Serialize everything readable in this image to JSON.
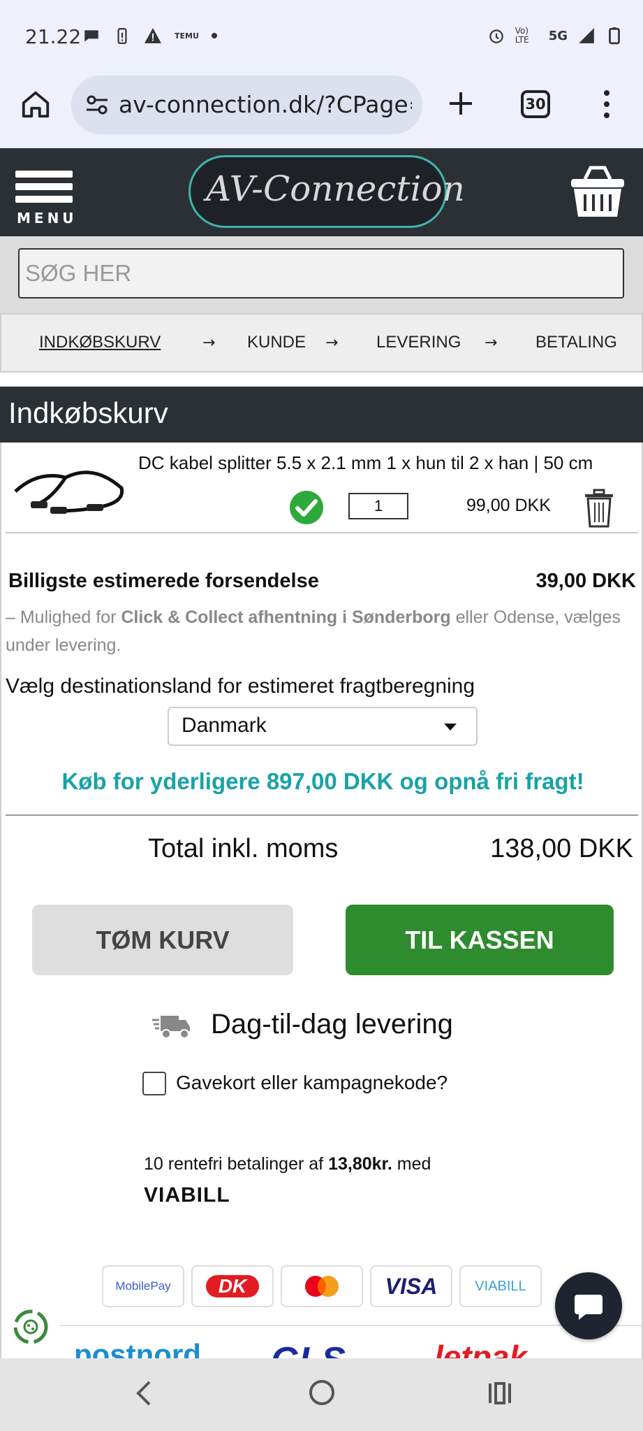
{
  "status": {
    "time": "21.22",
    "tiny_app_label": "TEMU",
    "net_label": "5G",
    "volte": "Vo) LTE"
  },
  "browser": {
    "url": "av-connection.dk/?CPage=",
    "tab_count": "30"
  },
  "header": {
    "menu_label": "MENU",
    "logo_text": "AV-Connection"
  },
  "search": {
    "placeholder": "SØG HER"
  },
  "steps": {
    "items": [
      "INDKØBSKURV",
      "KUNDE",
      "LEVERING",
      "BETALING"
    ],
    "arrow": "→"
  },
  "cart": {
    "title": "Indkøbskurv",
    "item": {
      "name": "DC kabel splitter 5.5 x 2.1 mm 1 x hun til 2 x han | 50 cm",
      "quantity": "1",
      "price": "99,00 DKK"
    },
    "shipping": {
      "title": "Billigste estimerede forsendelse",
      "price": "39,00 DKK",
      "note_prefix": "– Mulighed for ",
      "note_bold": "Click & Collect afhentning i Sønderborg",
      "note_suffix": " eller Odense, vælges under levering."
    },
    "destination_label": "Vælg destinationsland for estimeret fragtberegning",
    "country": "Danmark",
    "free_shipping": "Køb for yderligere 897,00 DKK og opnå fri fragt!",
    "total_label": "Total inkl. moms",
    "total_value": "138,00 DKK",
    "empty_button": "TØM KURV",
    "checkout_button": "TIL KASSEN",
    "delivery_text": "Dag-til-dag levering",
    "gift_label": "Gavekort eller kampagnekode?",
    "viabill": {
      "prefix": "10 rentefri betalinger af ",
      "amount": "13,80kr.",
      "suffix": " med",
      "logo": "VIABILL"
    }
  },
  "payment_logos": [
    "MobilePay",
    "DK",
    "Mastercard",
    "VISA",
    "VIABILL"
  ],
  "shipping_logos": [
    "postnord",
    "GLS",
    "letpak"
  ],
  "colors": {
    "dark_header": "#2b3035",
    "accent_teal": "#19a2a7",
    "checkout_green": "#2e8b2e"
  }
}
